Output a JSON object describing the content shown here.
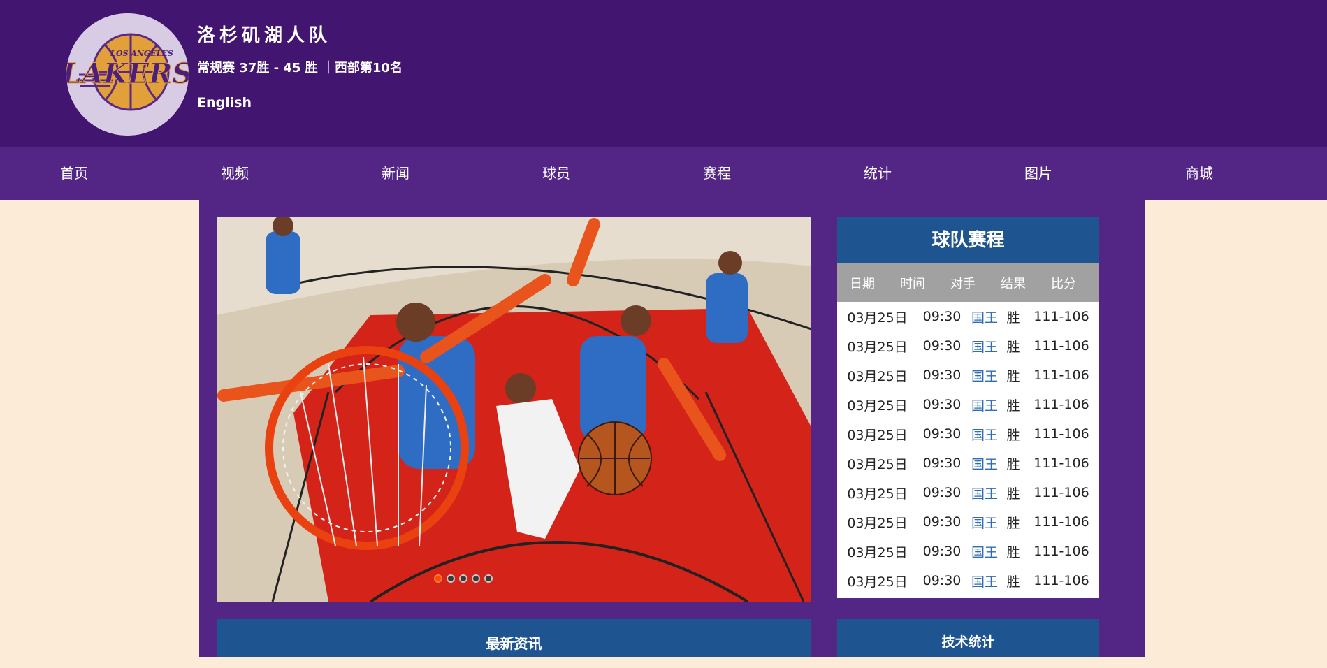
{
  "header": {
    "logo_text_top": "LOS ANGELES",
    "logo_text_main": "LAKERS",
    "team_name": "洛杉矶湖人队",
    "record": "常规赛 37胜 - 45 胜 ｜西部第10名",
    "language_link": "English"
  },
  "nav": {
    "items": [
      {
        "label": "首页"
      },
      {
        "label": "视频"
      },
      {
        "label": "新闻"
      },
      {
        "label": "球员"
      },
      {
        "label": "赛程"
      },
      {
        "label": "统计"
      },
      {
        "label": "图片"
      },
      {
        "label": "商城"
      }
    ]
  },
  "carousel": {
    "slide_count": 5,
    "active_index": 0,
    "accent_color": "#ff4a00"
  },
  "schedule": {
    "title": "球队赛程",
    "columns": [
      "日期",
      "时间",
      "对手",
      "结果",
      "比分"
    ],
    "rows": [
      {
        "date": "03月25日",
        "time": "09:30",
        "opponent": "国王",
        "result": "胜",
        "score": "111-106"
      },
      {
        "date": "03月25日",
        "time": "09:30",
        "opponent": "国王",
        "result": "胜",
        "score": "111-106"
      },
      {
        "date": "03月25日",
        "time": "09:30",
        "opponent": "国王",
        "result": "胜",
        "score": "111-106"
      },
      {
        "date": "03月25日",
        "time": "09:30",
        "opponent": "国王",
        "result": "胜",
        "score": "111-106"
      },
      {
        "date": "03月25日",
        "time": "09:30",
        "opponent": "国王",
        "result": "胜",
        "score": "111-106"
      },
      {
        "date": "03月25日",
        "time": "09:30",
        "opponent": "国王",
        "result": "胜",
        "score": "111-106"
      },
      {
        "date": "03月25日",
        "time": "09:30",
        "opponent": "国王",
        "result": "胜",
        "score": "111-106"
      },
      {
        "date": "03月25日",
        "time": "09:30",
        "opponent": "国王",
        "result": "胜",
        "score": "111-106"
      },
      {
        "date": "03月25日",
        "time": "09:30",
        "opponent": "国王",
        "result": "胜",
        "score": "111-106"
      },
      {
        "date": "03月25日",
        "time": "09:30",
        "opponent": "国王",
        "result": "胜",
        "score": "111-106"
      }
    ]
  },
  "sections": {
    "news_title": "最新资讯",
    "stats_title": "技术统计"
  },
  "colors": {
    "header_bg": "#421570",
    "nav_bg": "#532585",
    "page_bg": "#fbebd7",
    "panel_blue": "#1e5490",
    "table_header_gray": "#a1a1a1",
    "opponent_link": "#2e6db4"
  }
}
